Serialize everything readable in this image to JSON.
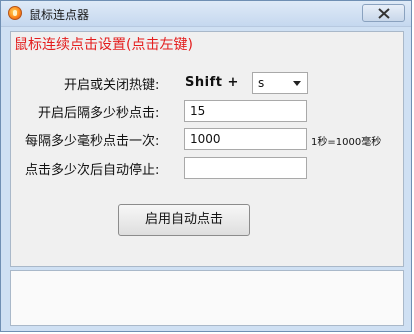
{
  "window": {
    "title": "鼠标连点器"
  },
  "panel": {
    "heading": "鼠标连续点击设置(点击左键)",
    "hotkey": {
      "label": "开启或关闭热键:",
      "modifier": "Shift +",
      "key_value": "s"
    },
    "start_delay": {
      "label": "开启后隔多少秒点击:",
      "value": "15"
    },
    "interval": {
      "label": "每隔多少毫秒点击一次:",
      "value": "1000",
      "hint": "1秒=1000毫秒"
    },
    "stop_after": {
      "label": "点击多少次后自动停止:",
      "value": ""
    },
    "start_button_label": "启用自动点击"
  },
  "colors": {
    "heading": "#e41d1d",
    "window_background": "#cfe0f3"
  },
  "icons": {
    "app": "app-icon",
    "close": "close-icon",
    "dropdown": "chevron-down-icon"
  }
}
